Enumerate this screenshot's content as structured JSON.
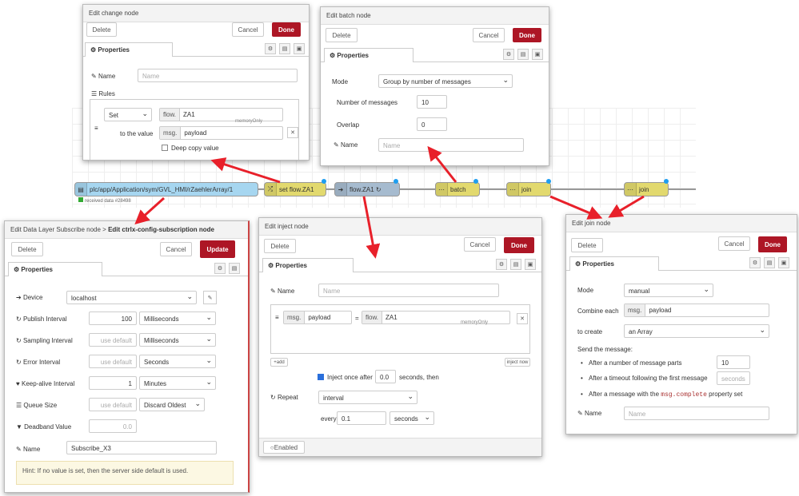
{
  "flow": {
    "nodes": {
      "subscribe": "plc/app/Application/sym/GVL_HMI/rZaehlerArray/1",
      "subscribe_status": "received data #28498",
      "set_flow": "set flow.ZA1",
      "flow_za1": "flow.ZA1 ↻",
      "batch": "batch",
      "join1": "join",
      "join2": "join"
    }
  },
  "change_node": {
    "title": "Edit change node",
    "delete": "Delete",
    "cancel": "Cancel",
    "done": "Done",
    "tab": "Properties",
    "name_label": "Name",
    "name_placeholder": "Name",
    "rules_label": "Rules",
    "rule_action": "Set",
    "rule_target_type": "flow.",
    "rule_target_value": "ZA1",
    "to_value_label": "to the value",
    "rule_source_type": "msg.",
    "rule_source_value": "payload",
    "deep_copy_label": "Deep copy value",
    "memory_label": "memoryOnly"
  },
  "batch_node": {
    "title": "Edit batch node",
    "delete": "Delete",
    "cancel": "Cancel",
    "done": "Done",
    "tab": "Properties",
    "mode_label": "Mode",
    "mode_value": "Group by number of messages",
    "number_label": "Number of messages",
    "number_value": "10",
    "overlap_label": "Overlap",
    "overlap_value": "0",
    "name_label": "Name",
    "name_placeholder": "Name"
  },
  "subscribe_node": {
    "title_prefix": "Edit Data Layer Subscribe node > ",
    "title_main": "Edit ctrlx-config-subscription node",
    "delete": "Delete",
    "cancel": "Cancel",
    "update": "Update",
    "tab": "Properties",
    "device_label": "Device",
    "device_value": "localhost",
    "publish_label": "Publish Interval",
    "publish_value": "100",
    "publish_unit": "Milliseconds",
    "sampling_label": "Sampling Interval",
    "sampling_placeholder": "use default",
    "sampling_unit": "Milliseconds",
    "error_label": "Error Interval",
    "error_placeholder": "use default",
    "error_unit": "Seconds",
    "keepalive_label": "Keep-alive Interval",
    "keepalive_value": "1",
    "keepalive_unit": "Minutes",
    "queue_label": "Queue Size",
    "queue_placeholder": "use default",
    "queue_mode": "Discard Oldest",
    "deadband_label": "Deadband Value",
    "deadband_placeholder": "0.0",
    "name_label": "Name",
    "name_value": "Subscribe_X3",
    "hint": "Hint: If no value is set, then the server side default is used."
  },
  "inject_node": {
    "title": "Edit inject node",
    "delete": "Delete",
    "cancel": "Cancel",
    "done": "Done",
    "tab": "Properties",
    "name_label": "Name",
    "name_placeholder": "Name",
    "prop_type": "msg.",
    "prop_value": "payload",
    "equals": "=",
    "val_type": "flow.",
    "val_value": "ZA1",
    "memory_label": "memoryOnly",
    "add_label": "+add",
    "inject_now": "inject now",
    "inject_once_label": "Inject once after",
    "inject_once_value": "0.0",
    "inject_once_suffix": "seconds, then",
    "repeat_label": "Repeat",
    "repeat_value": "interval",
    "every_label": "every",
    "every_value": "0.1",
    "every_unit": "seconds",
    "enabled_label": "Enabled"
  },
  "join_node": {
    "title": "Edit join node",
    "delete": "Delete",
    "cancel": "Cancel",
    "done": "Done",
    "tab": "Properties",
    "mode_label": "Mode",
    "mode_value": "manual",
    "combine_label": "Combine each",
    "combine_type": "msg.",
    "combine_value": "payload",
    "create_label": "to create",
    "create_value": "an Array",
    "send_label": "Send the message:",
    "bullet1": "After a number of message parts",
    "bullet1_value": "10",
    "bullet2": "After a timeout following the first message",
    "bullet2_placeholder": "seconds",
    "bullet3_prefix": "After a message with the ",
    "bullet3_code": "msg.complete",
    "bullet3_suffix": " property set",
    "name_label": "Name",
    "name_placeholder": "Name"
  },
  "colors": {
    "accent_red": "#ad1625",
    "arrow_red": "#e8202a",
    "node_blue": "#a6bbcf",
    "node_yellow": "#e2d96e",
    "link_blue": "#1e9ef0"
  }
}
